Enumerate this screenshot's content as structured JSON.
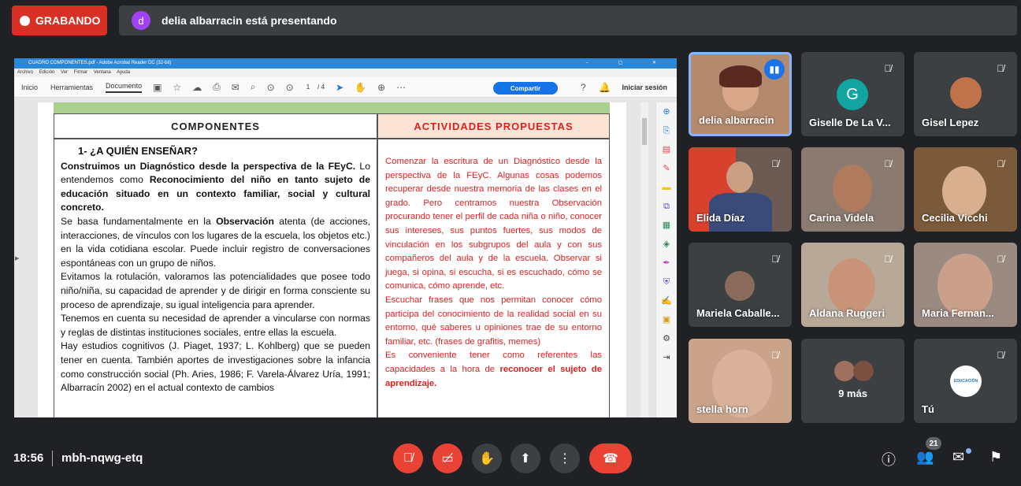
{
  "recording": {
    "label": "GRABANDO"
  },
  "presenter_bar": {
    "avatar_letter": "d",
    "text": "delia albarracin está presentando"
  },
  "acrobat": {
    "title": "CUADRO COMPONENTES.pdf - Adobe Acrobat Reader DC (32-bit)",
    "menu": [
      "Archivo",
      "Edición",
      "Ver",
      "Firmar",
      "Ventana",
      "Ayuda"
    ],
    "tabs": [
      "Inicio",
      "Herramientas",
      "Documento"
    ],
    "page_current": "1",
    "page_total": "/ 4",
    "share_label": "Compartir",
    "login_label": "Iniciar sesión"
  },
  "document": {
    "head_left": "COMPONENTES",
    "head_right": "ACTIVIDADES PROPUESTAS",
    "section_title": "1-  ¿A QUIÉN ENSEÑAR?",
    "p1_bold_a": "Construimos un Diagnóstico desde la perspectiva de la FEyC.",
    "p1_normal_a": " Lo entendemos como ",
    "p1_bold_b": "Reconocimiento del niño en tanto sujeto de educación situado en un contexto familiar, social y cultural concreto.",
    "p2_a": "Se basa fundamentalmente en la ",
    "p2_bold": "Observación",
    "p2_b": " atenta (de acciones, interacciones, de vínculos con los lugares de la escuela, los objetos etc.) en la vida cotidiana escolar. Puede incluir registro de conversaciones espontáneas con un grupo de niños.",
    "p3": "Evitamos la rotulación, valoramos las potencialidades que posee todo niño/niña, su capacidad de aprender y de dirigir en forma consciente su proceso de aprendizaje, su igual inteligencia para aprender.",
    "p4": "Tenemos en cuenta su necesidad de aprender a vincularse con normas y reglas de distintas instituciones sociales, entre ellas la escuela.",
    "p5": "Hay estudios cognitivos (J. Piaget, 1937; L. Kohlberg) que se pueden tener en cuenta. También aportes de investigaciones sobre la infancia como construcción social (Ph. Aries, 1986; F. Varela-Álvarez Uría, 1991; Albarracín 2002) en el actual contexto de cambios",
    "r1": "Comenzar la escritura de un Diagnóstico desde la perspectiva de la FEyC. Algunas cosas podemos recuperar desde nuestra memoria de las clases en el grado. Pero centramos nuestra Observación procurando tener el perfil de cada niña o niño, conocer sus intereses, sus puntos fuertes, sus modos de vinculación en los subgrupos del aula y con sus compañeros del aula y de la escuela. Observar si juega, si opina, si escucha, si es escuchado, cómo se comunica, cómo aprende, etc.",
    "r2": "Escuchar frases que nos permitan conocer cómo participa del conocimiento de la realidad social en su entorno, qué saberes u opiniones trae de su entorno familiar, etc. (frases de grafitis, memes)",
    "r3_a": "Es conveniente tener como referentes las capacidades a la hora de ",
    "r3_bold": "reconocer el sujeto de aprendizaje."
  },
  "participants": [
    {
      "name": "delia albarracin"
    },
    {
      "name": "Giselle De La V...",
      "avatar": "G"
    },
    {
      "name": "Gisel Lepez"
    },
    {
      "name": "Elida Díaz"
    },
    {
      "name": "Carina Videla"
    },
    {
      "name": "Cecilia Vicchi"
    },
    {
      "name": "Mariela Caballe..."
    },
    {
      "name": "Aldana Ruggeri"
    },
    {
      "name": "Maria Fernan..."
    },
    {
      "name": "stella horn"
    },
    {
      "name": "9 más"
    },
    {
      "name": "Tú",
      "logo_text": "EDUCACIÓN"
    }
  ],
  "bottom_bar": {
    "time": "18:56",
    "meeting_code": "mbh-nqwg-etq",
    "people_count": "21"
  },
  "colors": {
    "background": "#202124",
    "tile": "#3c4043",
    "red": "#ea4335",
    "blue": "#1a73e8"
  }
}
